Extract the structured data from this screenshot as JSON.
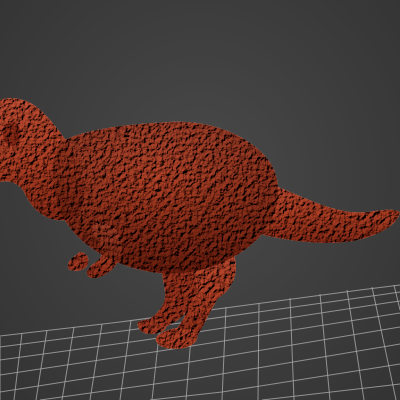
{
  "viewport": {
    "background_color": "#3d3d3d",
    "grid_color": "#a9a9a9",
    "model": {
      "name_icon": "dinosaur-sculpt-icon",
      "base_color": "#c46a4e",
      "shadow_color": "#7a3526",
      "highlight_color": "#e19278"
    }
  }
}
